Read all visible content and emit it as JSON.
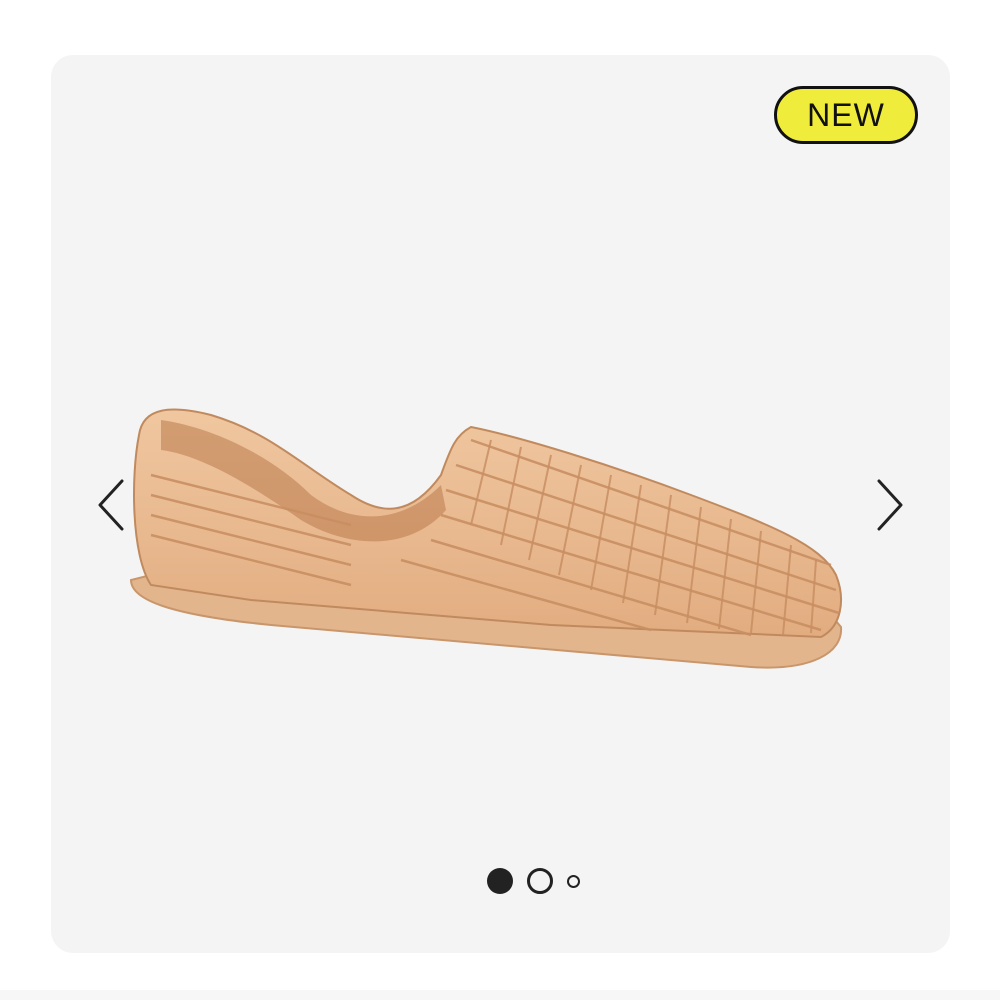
{
  "product_card": {
    "badge": "NEW",
    "image": {
      "icon": "woven-leather-huarache-sandal",
      "colors": {
        "leather": "#e8b98f",
        "sole": "#e2b48c",
        "background": "#f4f4f4"
      }
    },
    "carousel": {
      "slide_count": 3,
      "active_index": 0
    },
    "nav": {
      "prev_icon": "chevron-left-icon",
      "next_icon": "chevron-right-icon"
    },
    "colors": {
      "badge_fill": "#f0ec3c",
      "dot": "#222222"
    }
  }
}
